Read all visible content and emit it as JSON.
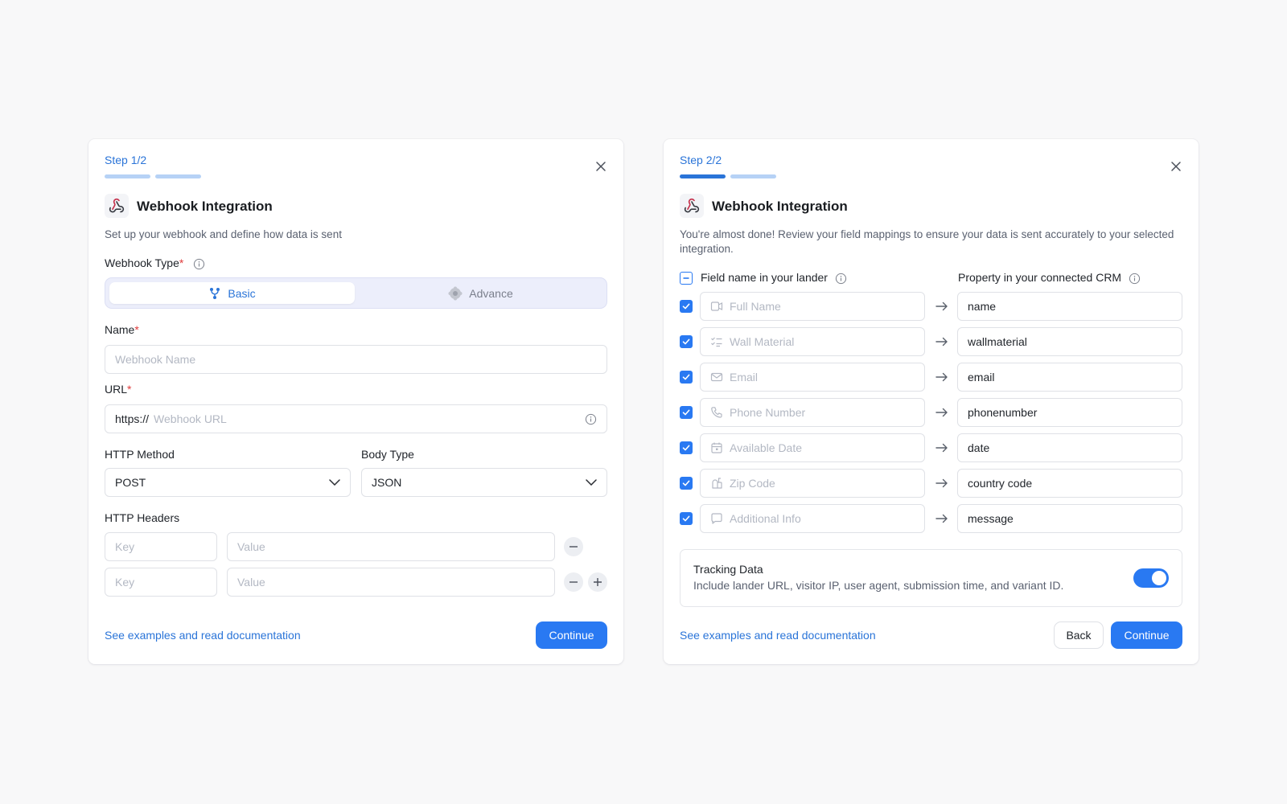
{
  "step1": {
    "step_label": "Step 1/2",
    "title": "Webhook Integration",
    "description": "Set up your webhook and define how data is sent",
    "webhook_type_label": "Webhook Type",
    "required_mark": "*",
    "type_options": [
      {
        "label": "Basic",
        "active": true
      },
      {
        "label": "Advance",
        "active": false
      }
    ],
    "name_label": "Name",
    "name_placeholder": "Webhook Name",
    "url_label": "URL",
    "url_prefix": "https://",
    "url_placeholder": "Webhook URL",
    "http_method_label": "HTTP Method",
    "http_method_value": "POST",
    "body_type_label": "Body Type",
    "body_type_value": "JSON",
    "headers_label": "HTTP Headers",
    "headers": [
      {
        "key_placeholder": "Key",
        "value_placeholder": "Value"
      },
      {
        "key_placeholder": "Key",
        "value_placeholder": "Value"
      }
    ],
    "doc_link": "See examples and read documentation",
    "continue_label": "Continue"
  },
  "step2": {
    "step_label": "Step 2/2",
    "title": "Webhook Integration",
    "description": "You're almost done! Review your field mappings to ensure your data is sent accurately to your selected integration.",
    "col_lander": "Field name in your lander",
    "col_crm": "Property in your connected CRM",
    "mappings": [
      {
        "field": "Full Name",
        "icon": "id-card-icon",
        "crm": "name",
        "checked": true
      },
      {
        "field": "Wall Material",
        "icon": "checklist-icon",
        "crm": "wallmaterial",
        "checked": true
      },
      {
        "field": "Email",
        "icon": "mail-icon",
        "crm": "email",
        "checked": true
      },
      {
        "field": "Phone Number",
        "icon": "phone-icon",
        "crm": "phonenumber",
        "checked": true
      },
      {
        "field": "Available Date",
        "icon": "calendar-icon",
        "crm": "date",
        "checked": true
      },
      {
        "field": "Zip Code",
        "icon": "mailbox-icon",
        "crm": "country code",
        "checked": true
      },
      {
        "field": "Additional Info",
        "icon": "comment-icon",
        "crm": "message",
        "checked": true
      }
    ],
    "tracking_title": "Tracking Data",
    "tracking_desc": "Include lander URL, visitor IP, user agent, submission time, and variant ID.",
    "tracking_enabled": true,
    "doc_link": "See examples and read documentation",
    "back_label": "Back",
    "continue_label": "Continue"
  },
  "colors": {
    "accent": "#2979f2",
    "link": "#2a74d8",
    "required": "#e03c3c",
    "progress_todo": "#b6d2f6"
  }
}
